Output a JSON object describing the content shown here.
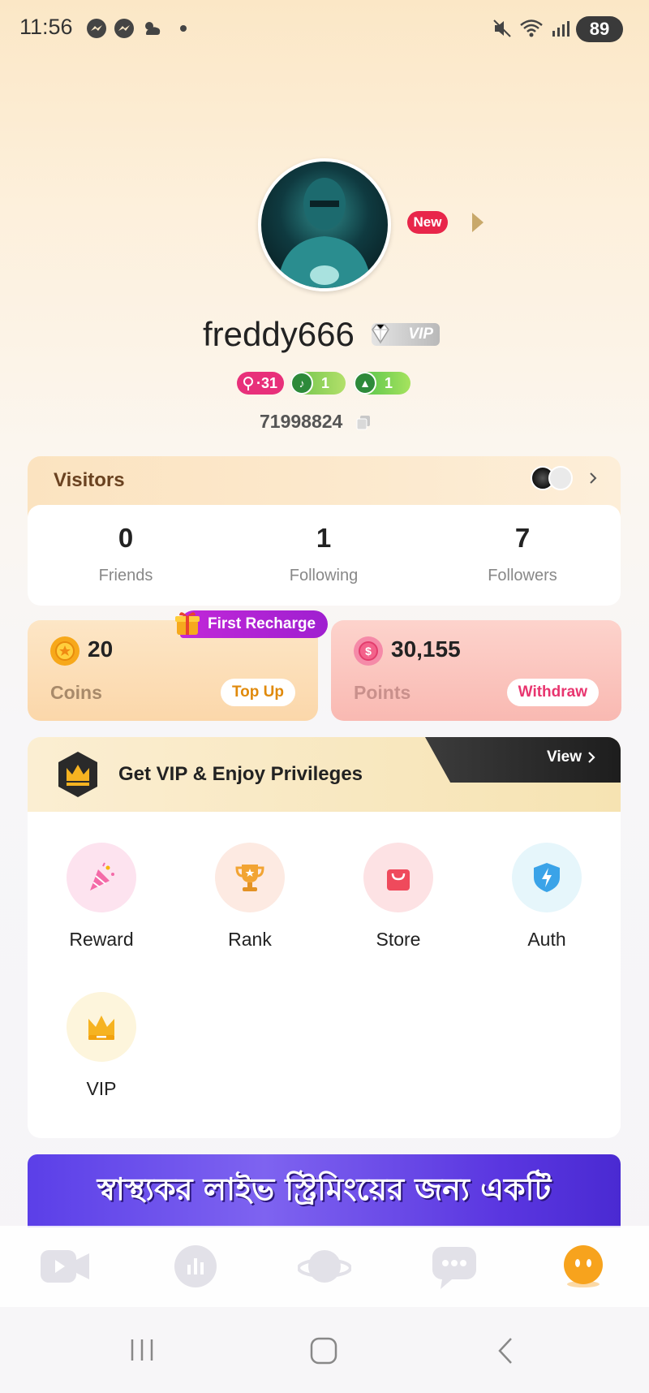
{
  "status_bar": {
    "time": "11:56",
    "battery": "89",
    "icons": [
      "messenger-icon",
      "messenger-icon",
      "weather-icon",
      "dot-icon",
      "mute-icon",
      "wifi-icon",
      "signal-icon",
      "battery-icon"
    ]
  },
  "profile": {
    "new_badge": "New",
    "username": "freddy666",
    "vip_tag": "VIP",
    "levels": [
      {
        "label": "31",
        "icon": "lightning-icon",
        "color": "#e8307a"
      },
      {
        "label": "1",
        "icon": "music-note-icon",
        "color": "#6cc24a"
      },
      {
        "label": "1",
        "icon": "triangle-icon",
        "color": "#4cbf4a"
      }
    ],
    "user_id": "71998824"
  },
  "visitors": {
    "title": "Visitors",
    "stats": [
      {
        "value": "0",
        "label": "Friends"
      },
      {
        "value": "1",
        "label": "Following"
      },
      {
        "value": "7",
        "label": "Followers"
      }
    ]
  },
  "wallet": {
    "first_recharge": "First Recharge",
    "coins": {
      "value": "20",
      "label": "Coins",
      "button": "Top Up"
    },
    "points": {
      "value": "30,155",
      "label": "Points",
      "button": "Withdraw"
    }
  },
  "vip_banner": {
    "text": "Get VIP & Enjoy Privileges",
    "view": "View"
  },
  "menu": [
    {
      "label": "Reward",
      "icon": "party-popper-icon",
      "bg": "#fde3ef"
    },
    {
      "label": "Rank",
      "icon": "trophy-icon",
      "bg": "#fdeae2"
    },
    {
      "label": "Store",
      "icon": "shopping-bag-icon",
      "bg": "#fde2e4"
    },
    {
      "label": "Auth",
      "icon": "shield-lightning-icon",
      "bg": "#e6f6fb"
    },
    {
      "label": "VIP",
      "icon": "crown-icon",
      "bg": "#fdf5dc"
    }
  ],
  "promo_banner": {
    "text": "স্বাস্থ্যকর লাইভ স্ট্রিমিংয়ের জন্য একটি"
  },
  "tabbar": [
    "video-icon",
    "chart-icon",
    "planet-icon",
    "chat-icon",
    "profile-face-icon"
  ],
  "accent": "#f5a623"
}
